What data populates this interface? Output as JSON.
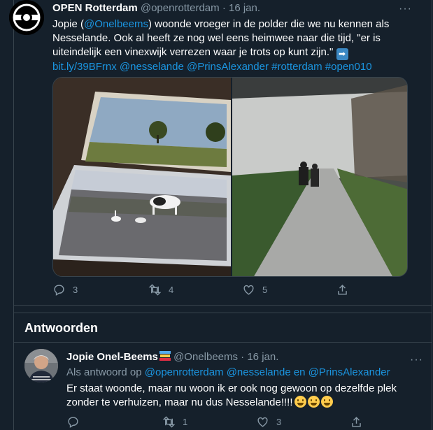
{
  "tweet": {
    "author_name": "OPEN Rotterdam",
    "author_handle": "@openrotterdam",
    "separator": "·",
    "date": "16 jan.",
    "text_1": "Jopie (",
    "mention_1": "@Onelbeems",
    "text_2": ") woonde vroeger in de polder die we nu kennen als Nesselande. Ook al heeft ze nog wel eens heimwee naar die tijd, \"er is uiteindelijk een vinexwijk verrezen waar je trots op kunt zijn.\" ",
    "arrow": "➡",
    "link": "bit.ly/39BFrnx",
    "hashtags": "@nesselande @PrinsAlexander #rotterdam #open010",
    "reply_count": "3",
    "retweet_count": "4",
    "like_count": "5"
  },
  "section": {
    "title": "Antwoorden"
  },
  "reply": {
    "author_name": "Jopie Onel-Beems",
    "author_handle": "@Onelbeems",
    "separator": "·",
    "date": "16 jan.",
    "replying_prefix": "Als antwoord op",
    "replying_to": "@openrotterdam @nesselande en @PrinsAlexander",
    "text": "Er staat woonde, maar nu woon ik er ook nog gewoon op dezelfde plek zonder te verhuizen, maar nu dus Nesselande!!!!",
    "reply_count": "",
    "retweet_count": "1",
    "like_count": "3"
  },
  "icons": {
    "reply": "reply-icon",
    "retweet": "retweet-icon",
    "like": "heart-icon",
    "share": "share-icon",
    "more": "more-icon"
  },
  "colors": {
    "background": "#15202b",
    "link": "#1b95e0",
    "muted": "#8899a6",
    "border": "#38444d"
  }
}
